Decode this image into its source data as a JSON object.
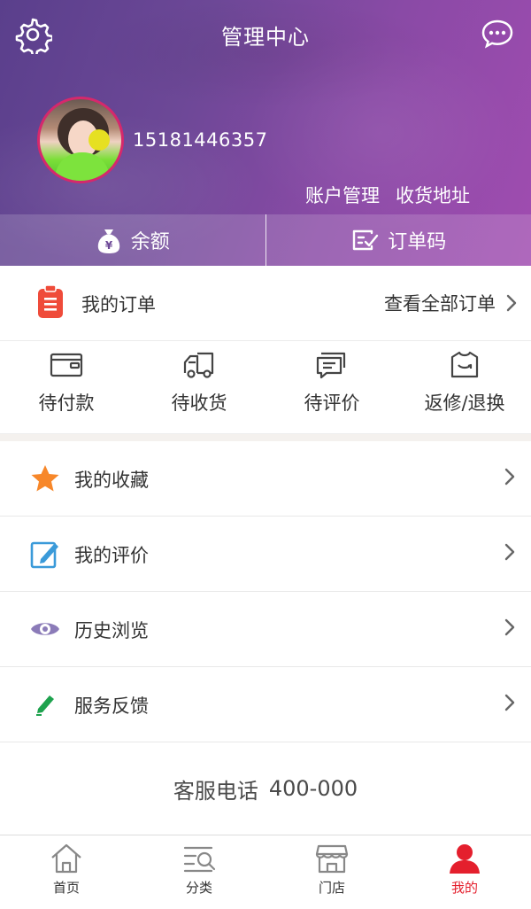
{
  "header": {
    "title": "管理中心",
    "left_icon": "gear-icon",
    "right_icon": "chat-bubble-icon"
  },
  "profile": {
    "phone": "15181446357",
    "account_management": "账户管理",
    "shipping_address": "收货地址"
  },
  "summary": {
    "balance_label": "余额",
    "order_code_label": "订单码"
  },
  "orders": {
    "title": "我的订单",
    "view_all": "查看全部订单"
  },
  "quick_actions": [
    {
      "label": "待付款",
      "icon": "wallet-icon"
    },
    {
      "label": "待收货",
      "icon": "truck-icon"
    },
    {
      "label": "待评价",
      "icon": "comment-icon"
    },
    {
      "label": "返修/退换",
      "icon": "shirt-icon"
    }
  ],
  "menu": [
    {
      "label": "我的收藏",
      "icon": "star-icon"
    },
    {
      "label": "我的评价",
      "icon": "edit-note-icon"
    },
    {
      "label": "历史浏览",
      "icon": "eye-icon"
    },
    {
      "label": "服务反馈",
      "icon": "pencil-icon"
    }
  ],
  "service": {
    "label": "客服电话",
    "number": "400-000"
  },
  "tabs": [
    {
      "label": "首页",
      "icon": "home-icon"
    },
    {
      "label": "分类",
      "icon": "category-icon"
    },
    {
      "label": "门店",
      "icon": "store-icon"
    },
    {
      "label": "我的",
      "icon": "user-icon",
      "active": true
    }
  ],
  "colors": {
    "accent": "#e41f2d",
    "hero_start": "#5a3f8c",
    "hero_end": "#a04cb0"
  }
}
